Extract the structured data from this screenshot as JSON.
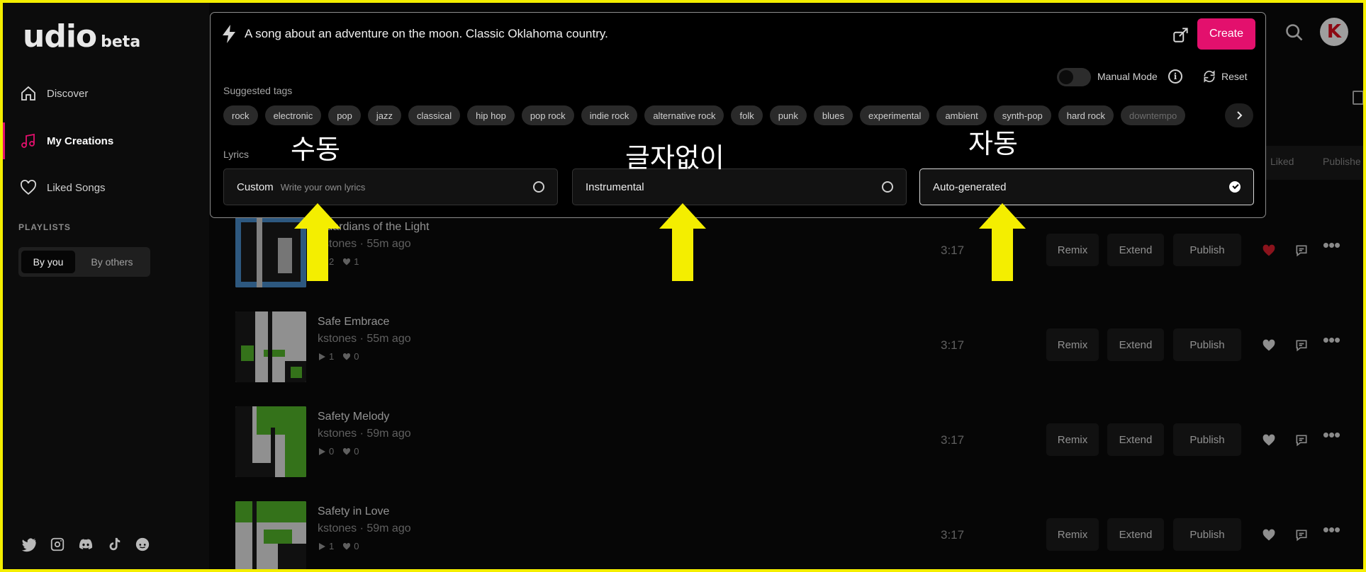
{
  "sidebar": {
    "logo": "udio",
    "logo_suffix": "beta",
    "nav": [
      {
        "label": "Discover",
        "icon": "home-icon"
      },
      {
        "label": "My Creations",
        "icon": "music-note-icon"
      },
      {
        "label": "Liked Songs",
        "icon": "heart-icon"
      }
    ],
    "playlists_title": "PLAYLISTS",
    "playlist_toggle": [
      "By you",
      "By others"
    ],
    "social_icons": [
      "twitter-icon",
      "instagram-icon",
      "discord-icon",
      "tiktok-icon",
      "reddit-icon"
    ]
  },
  "header": {
    "avatar_letter": "K",
    "filter_tabs": [
      "Liked",
      "Publishe"
    ]
  },
  "modal": {
    "prompt": "A song about an adventure on the moon. Classic Oklahoma country.",
    "create_label": "Create",
    "manual_mode_label": "Manual Mode",
    "reset_label": "Reset",
    "suggested_tags_label": "Suggested tags",
    "tags": [
      "rock",
      "electronic",
      "pop",
      "jazz",
      "classical",
      "hip hop",
      "pop rock",
      "indie rock",
      "alternative rock",
      "folk",
      "punk",
      "blues",
      "experimental",
      "ambient",
      "synth-pop",
      "hard rock",
      "downtempo"
    ],
    "lyrics_label": "Lyrics",
    "options": [
      {
        "label": "Custom",
        "sub": "Write your own lyrics",
        "selected": false
      },
      {
        "label": "Instrumental",
        "sub": "",
        "selected": false
      },
      {
        "label": "Auto-generated",
        "sub": "",
        "selected": true
      }
    ]
  },
  "annotations": {
    "manual": "수동",
    "no_lyrics": "글자없이",
    "auto": "자동",
    "arrow_color": "#f4ee00"
  },
  "songs": [
    {
      "title": "Guardians of the Light",
      "artist": "kstones",
      "age": "55m ago",
      "plays": "2",
      "likes": "1",
      "duration": "3:17",
      "liked": true
    },
    {
      "title": "Safe Embrace",
      "artist": "kstones",
      "age": "55m ago",
      "plays": "1",
      "likes": "0",
      "duration": "3:17",
      "liked": false
    },
    {
      "title": "Safety Melody",
      "artist": "kstones",
      "age": "59m ago",
      "plays": "0",
      "likes": "0",
      "duration": "3:17",
      "liked": false
    },
    {
      "title": "Safety in Love",
      "artist": "kstones",
      "age": "59m ago",
      "plays": "1",
      "likes": "0",
      "duration": "3:17",
      "liked": false
    }
  ],
  "row_actions": {
    "remix": "Remix",
    "extend": "Extend",
    "publish": "Publish"
  },
  "colors": {
    "accent": "#e3106d",
    "liked_heart": "#e0202e",
    "frame": "#f4ee00"
  }
}
